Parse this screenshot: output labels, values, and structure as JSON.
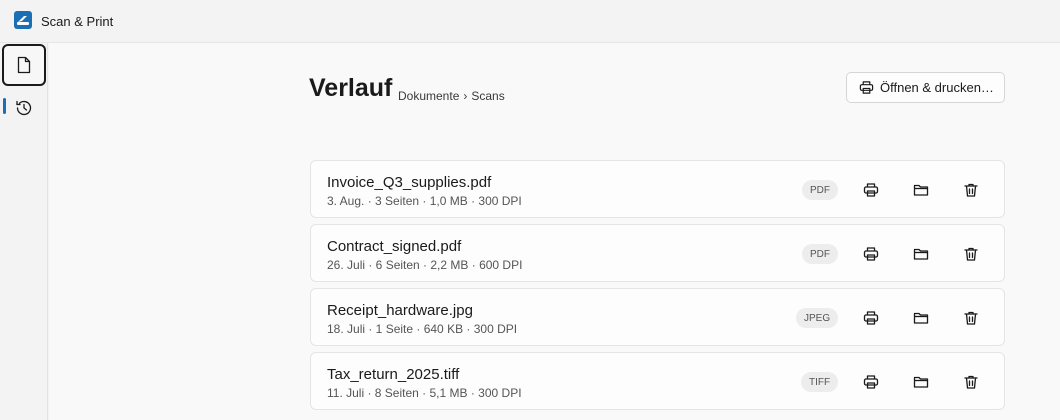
{
  "app": {
    "title": "Scan & Print",
    "accent": "#1a6fb5"
  },
  "rail": {
    "items": [
      {
        "name": "documents",
        "icon": "document-icon",
        "selected": true
      },
      {
        "name": "history",
        "icon": "history-icon",
        "selected": false
      }
    ]
  },
  "header": {
    "title": "Verlauf",
    "breadcrumb": {
      "part1": "Dokumente",
      "separator": "›",
      "part2": "Scans"
    },
    "open_print_label": "Öffnen & drucken…"
  },
  "files": [
    {
      "name": "Invoice_Q3_supplies.pdf",
      "meta": "3. Aug. · 3 Seiten · 1,0 MB · 300 DPI",
      "type": "PDF"
    },
    {
      "name": "Contract_signed.pdf",
      "meta": "26. Juli · 6 Seiten · 2,2 MB · 600 DPI",
      "type": "PDF"
    },
    {
      "name": "Receipt_hardware.jpg",
      "meta": "18. Juli · 1 Seite · 640 KB · 300 DPI",
      "type": "JPEG"
    },
    {
      "name": "Tax_return_2025.tiff",
      "meta": "11. Juli · 8 Seiten · 5,1 MB · 300 DPI",
      "type": "TIFF"
    }
  ]
}
